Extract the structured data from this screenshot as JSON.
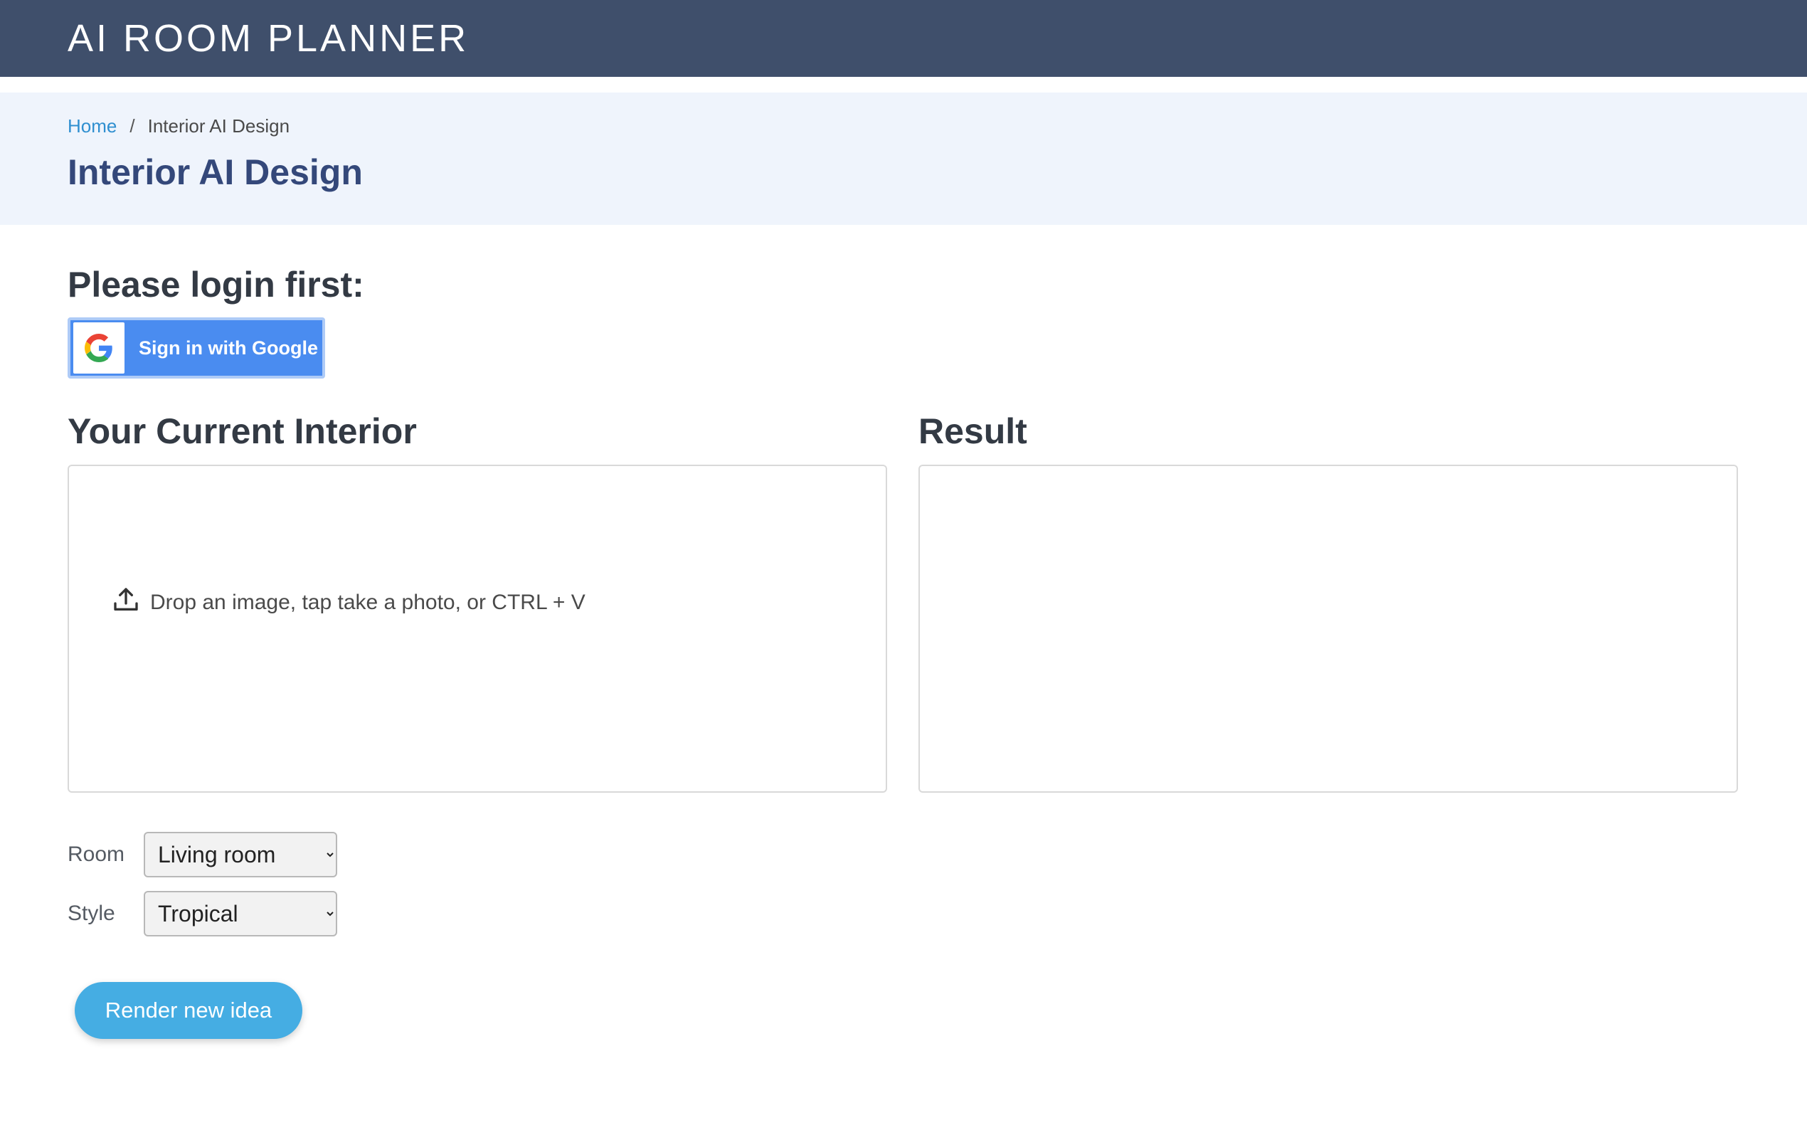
{
  "header": {
    "brand": "AI ROOM PLANNER",
    "bar_color": "#3f4f6b"
  },
  "breadcrumb": {
    "home": "Home",
    "separator": "/",
    "current": "Interior AI Design"
  },
  "page": {
    "title": "Interior AI Design"
  },
  "login": {
    "heading": "Please login first:",
    "google_button": "Sign in with Google"
  },
  "upload": {
    "title": "Your Current Interior",
    "hint": "Drop an image, tap take a photo, or CTRL + V"
  },
  "result": {
    "title": "Result"
  },
  "form": {
    "room_label": "Room",
    "room_value": "Living room",
    "style_label": "Style",
    "style_value": "Tropical"
  },
  "actions": {
    "render_label": "Render new idea",
    "render_color": "#45ade3"
  }
}
